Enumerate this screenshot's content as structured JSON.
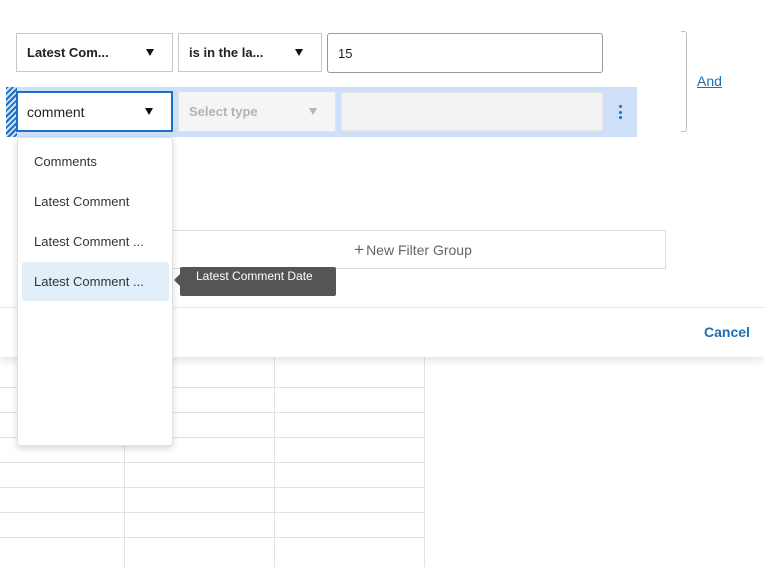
{
  "filters": {
    "row1": {
      "field": "Latest Com...",
      "operator": "is in the la...",
      "value": "15"
    },
    "row2": {
      "field_search": "comment",
      "type_placeholder": "Select type"
    },
    "logic_link": "And",
    "new_group_label": "New Filter Group"
  },
  "dropdown": {
    "options": [
      "Comments",
      "Latest Comment",
      "Latest Comment ...",
      "Latest Comment ..."
    ],
    "hovered_index": 3
  },
  "tooltip": "Latest Comment Date",
  "footer": {
    "cancel_label": "Cancel"
  },
  "colors": {
    "accent": "#1d6fc4",
    "link": "#1a6fb5",
    "row_highlight": "#cde0f7",
    "tooltip_bg": "#555555"
  }
}
